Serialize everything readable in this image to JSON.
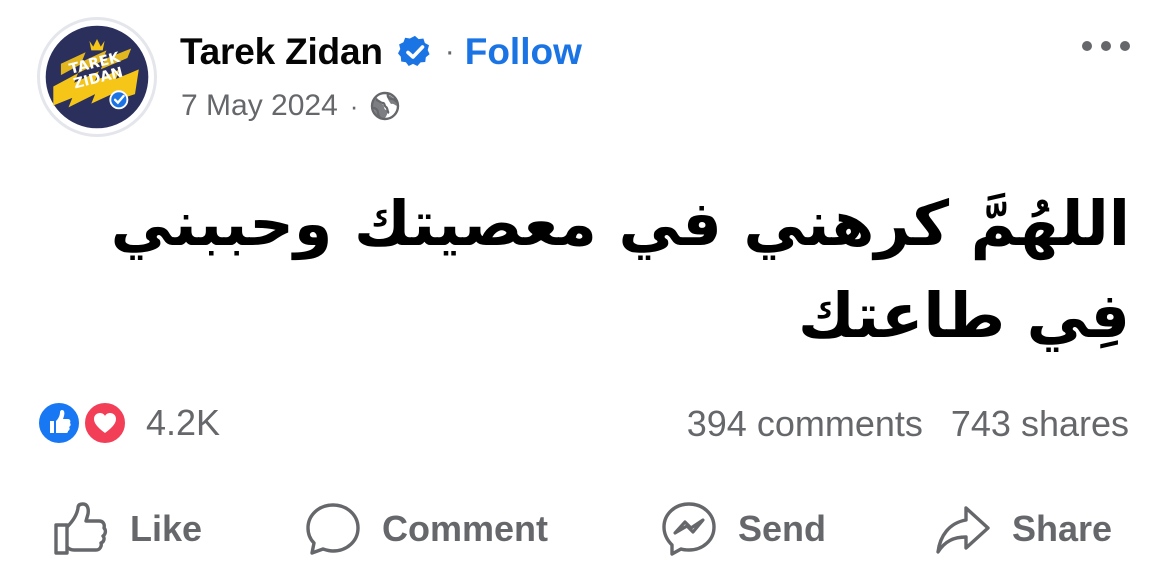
{
  "post": {
    "author": "Tarek Zidan",
    "follow_label": "Follow",
    "separator": "·",
    "date": "7 May 2024",
    "audience_icon": "globe-icon",
    "avatar_text_line1": "TAREK",
    "avatar_text_line2": "ZIDAN",
    "text": "اللهُمَّ كرهني في معصيتك وحببني فِي طاعتك"
  },
  "engagement": {
    "reactions": [
      "like",
      "love"
    ],
    "reaction_count": "4.2K",
    "comments": "394 comments",
    "shares": "743 shares"
  },
  "actions": {
    "like": "Like",
    "comment": "Comment",
    "send": "Send",
    "share": "Share"
  },
  "colors": {
    "accent": "#1b74e4",
    "secondary_text": "#65676b",
    "like_blue": "#1877f2",
    "love_red": "#f33e58"
  }
}
